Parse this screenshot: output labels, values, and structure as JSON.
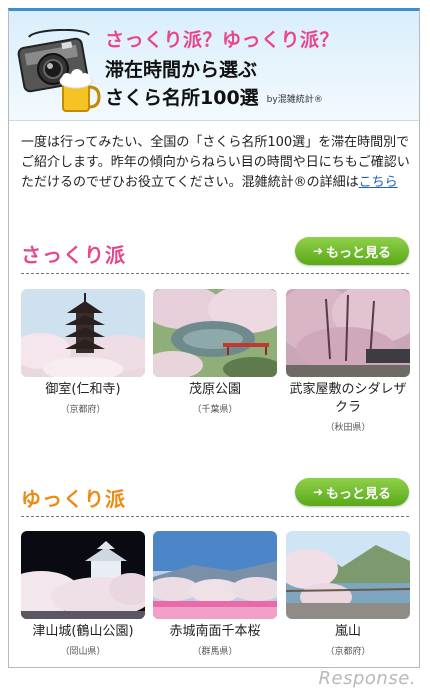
{
  "header": {
    "tagline": "さっくり派？ゆっくり派？",
    "title_line1": "滞在時間から選ぶ",
    "title_line2": "さくら名所100選",
    "by": "by混雑統計®"
  },
  "intro": {
    "text": "一度は行ってみたい、全国の「さくら名所100選」を滞在時間別でご紹介します。昨年の傾向からねらい目の時間や日にちもご確認いただけるのでぜひお役立てください。混雑統計®の詳細は",
    "link": "こちら"
  },
  "sections": [
    {
      "title": "さっくり派",
      "color": "#e8478c",
      "more_label": "もっと見る",
      "spots": [
        {
          "name": "御室(仁和寺)",
          "pref": "（京都府）"
        },
        {
          "name": "茂原公園",
          "pref": "（千葉県）"
        },
        {
          "name": "武家屋敷のシダレザクラ",
          "pref": "（秋田県）"
        }
      ]
    },
    {
      "title": "ゆっくり派",
      "color": "#f08a12",
      "more_label": "もっと見る",
      "spots": [
        {
          "name": "津山城(鶴山公園)",
          "pref": "（岡山県）"
        },
        {
          "name": "赤城南面千本桜",
          "pref": "（群馬県）"
        },
        {
          "name": "嵐山",
          "pref": "（京都府）"
        }
      ]
    }
  ],
  "watermark": "Response.",
  "colors": {
    "accent": "#3a8fd1",
    "button": "#6cbb24",
    "link": "#1f5cc4"
  }
}
